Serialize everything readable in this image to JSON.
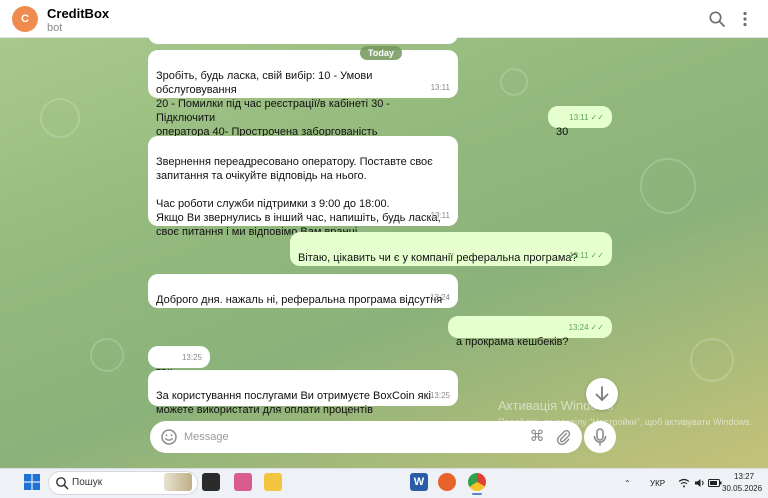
{
  "header": {
    "avatar_letter": "C",
    "title": "CreditBox",
    "subtitle": "bot",
    "icons": [
      "search-icon",
      "more-vertical-icon"
    ]
  },
  "chat": {
    "date_badge": "Today",
    "messages": [
      {
        "dir": "in",
        "text": "Зробіть, будь ласка, свій вибір: 10 - Умови обслуговування\n20 - Помилки під час реєстрації/в кабінеті 30 - Підключити\nоператора 40- Прострочена заборгованість",
        "time": "13:11"
      },
      {
        "dir": "out",
        "text": "30",
        "time": "13:11"
      },
      {
        "dir": "in",
        "text": "Звернення переадресовано оператору. Поставте своє\nзапитання та очікуйте відповідь на нього.\n\nЧас роботи служби підтримки з 9:00 до 18:00.\nЯкщо Ви звернулись в інший час, напишіть, будь ласка,\nсвоє питання і ми відповімо Вам вранці.",
        "time": "13:11"
      },
      {
        "dir": "out",
        "text": "Вітаю, цікавить чи є у компанії реферальна програма?",
        "time": "13:11"
      },
      {
        "dir": "in",
        "text": "Доброго дня. нажаль ні, реферальна програма відсутня",
        "time": "13:24"
      },
      {
        "dir": "out",
        "text": "а прокрама кешбеків?",
        "time": "13:24"
      },
      {
        "dir": "in",
        "text": "так .",
        "time": "13:25"
      },
      {
        "dir": "in",
        "text": "За користування послугами Ви отримуєте BoxCoin які\nможете використати для оплати процентів",
        "time": "13:25"
      }
    ]
  },
  "composer": {
    "placeholder": "Message",
    "icons": [
      "emoji-icon",
      "command-icon",
      "paperclip-icon",
      "microphone-icon"
    ]
  },
  "watermark": {
    "line1": "Активація Windows",
    "line2": "Перейдіть до розділу \"Настройки\", щоб активувати Windows."
  },
  "taskbar": {
    "search_placeholder": "Пошук",
    "language": "УКР",
    "time": "13:27",
    "date": "30.05.2026"
  },
  "colors": {
    "accent": "#ef8b4f",
    "outgoing_bubble": "#e6ffcf",
    "read_ticks": "#5ea45a"
  }
}
